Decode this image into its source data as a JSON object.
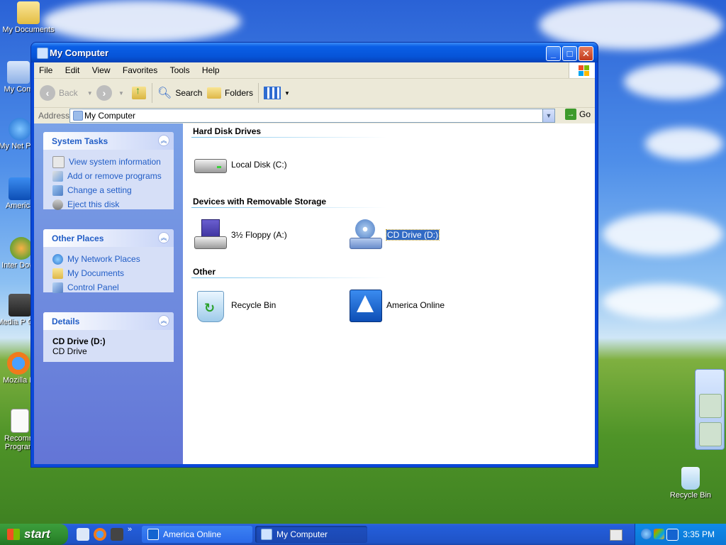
{
  "desktop": {
    "icons": [
      {
        "label": "My Documents"
      },
      {
        "label": "My Com"
      },
      {
        "label": "My Net Plac"
      },
      {
        "label": "America"
      },
      {
        "label": "Inter Downl"
      },
      {
        "label": "Media P Clas"
      },
      {
        "label": "Mozilla F"
      },
      {
        "label": "Recomm Program"
      },
      {
        "label": "Recycle Bin"
      }
    ]
  },
  "window": {
    "title": "My Computer",
    "menu": [
      "File",
      "Edit",
      "View",
      "Favorites",
      "Tools",
      "Help"
    ],
    "toolbar": {
      "back_label": "Back",
      "search_label": "Search",
      "folders_label": "Folders"
    },
    "address": {
      "label": "Address",
      "value": "My Computer",
      "go_label": "Go"
    },
    "taskpane": {
      "system_tasks": {
        "title": "System Tasks",
        "items": [
          "View system information",
          "Add or remove programs",
          "Change a setting",
          "Eject this disk"
        ]
      },
      "other_places": {
        "title": "Other Places",
        "items": [
          "My Network Places",
          "My Documents",
          "Control Panel"
        ]
      },
      "details": {
        "title": "Details",
        "name": "CD Drive (D:)",
        "type": "CD Drive"
      }
    },
    "groups": [
      {
        "heading": "Hard Disk Drives",
        "items": [
          "Local Disk (C:)"
        ]
      },
      {
        "heading": "Devices with Removable Storage",
        "items": [
          "3½ Floppy (A:)",
          "CD Drive (D:)"
        ]
      },
      {
        "heading": "Other",
        "items": [
          "Recycle Bin",
          "America Online"
        ]
      }
    ],
    "selected_item": "CD Drive (D:)"
  },
  "taskbar": {
    "start_label": "start",
    "tasks": [
      {
        "label": "America Online"
      },
      {
        "label": "My Computer"
      }
    ],
    "clock": "3:35 PM",
    "overflow": "»"
  },
  "colors": {
    "title_blue": "#0654d8",
    "link_blue": "#215dc6",
    "selection": "#316ac5",
    "start_green": "#2f8b2f"
  }
}
